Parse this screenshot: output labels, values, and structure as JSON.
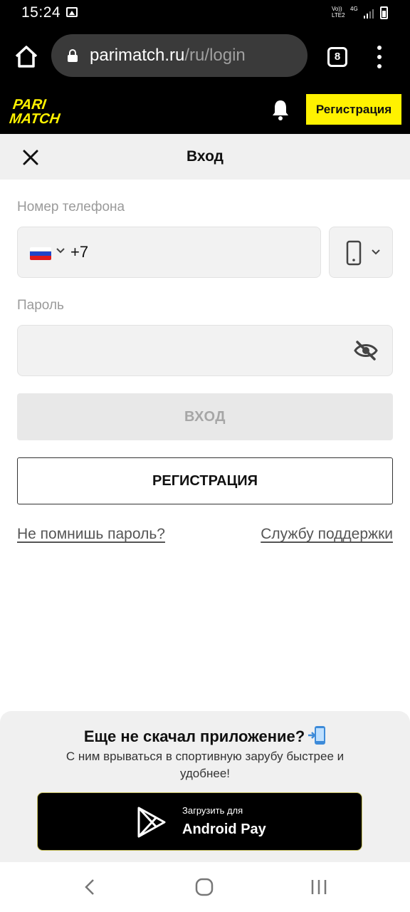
{
  "status_bar": {
    "time": "15:24",
    "volte": "Vo)) LTE2",
    "network": "4G"
  },
  "browser": {
    "url_host": "parimatch.ru",
    "url_path": "/ru/login",
    "tab_count": "8"
  },
  "header": {
    "register_label": "Регистрация",
    "logo_line1": "PARI",
    "logo_line2": "MATCH",
    "brand_color": "#fff200"
  },
  "login": {
    "title": "Вход",
    "phone_label": "Номер телефона",
    "phone_code": "+7",
    "phone_value": "",
    "password_label": "Пароль",
    "password_value": "",
    "login_button": "ВХОД",
    "register_button": "РЕГИСТРАЦИЯ",
    "forgot_link": "Не помнишь пароль?",
    "support_link": "Службу поддержки"
  },
  "promo": {
    "title": "Еще не скачал приложение?",
    "text": "С ним врываться в спортивную зарубу быстрее и удобнее!",
    "store_small": "Загрузить для",
    "store_big": "Android Pay"
  }
}
